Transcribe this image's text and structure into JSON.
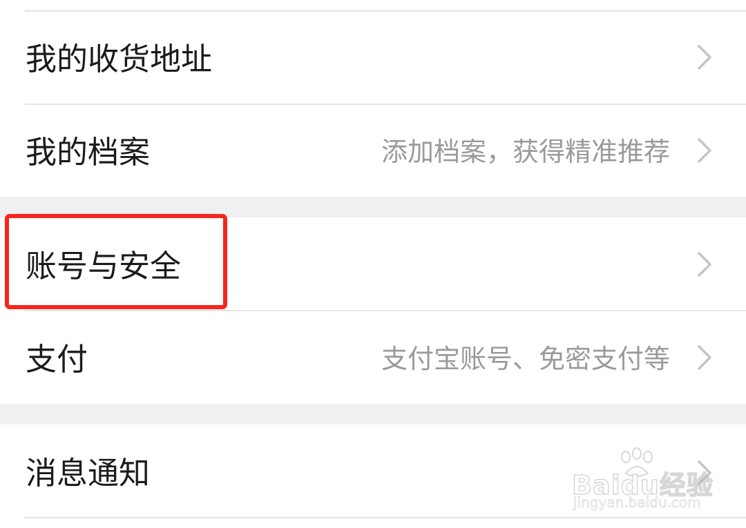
{
  "settings": {
    "items": [
      {
        "label": "我的收货地址",
        "hint": ""
      },
      {
        "label": "我的档案",
        "hint": "添加档案，获得精准推荐"
      },
      {
        "label": "账号与安全",
        "hint": ""
      },
      {
        "label": "支付",
        "hint": "支付宝账号、免密支付等"
      },
      {
        "label": "消息通知",
        "hint": ""
      }
    ],
    "chevron_icon": "chevron-right-icon"
  },
  "watermark": {
    "brand": "Baidu经验",
    "url": "jingyan.baidu.com"
  },
  "colors": {
    "highlight": "#f5261e",
    "text": "#1b1b1b",
    "hint": "#9a9a9a",
    "divider": "#e4e4e4",
    "section_gap": "#f0f0f0"
  }
}
